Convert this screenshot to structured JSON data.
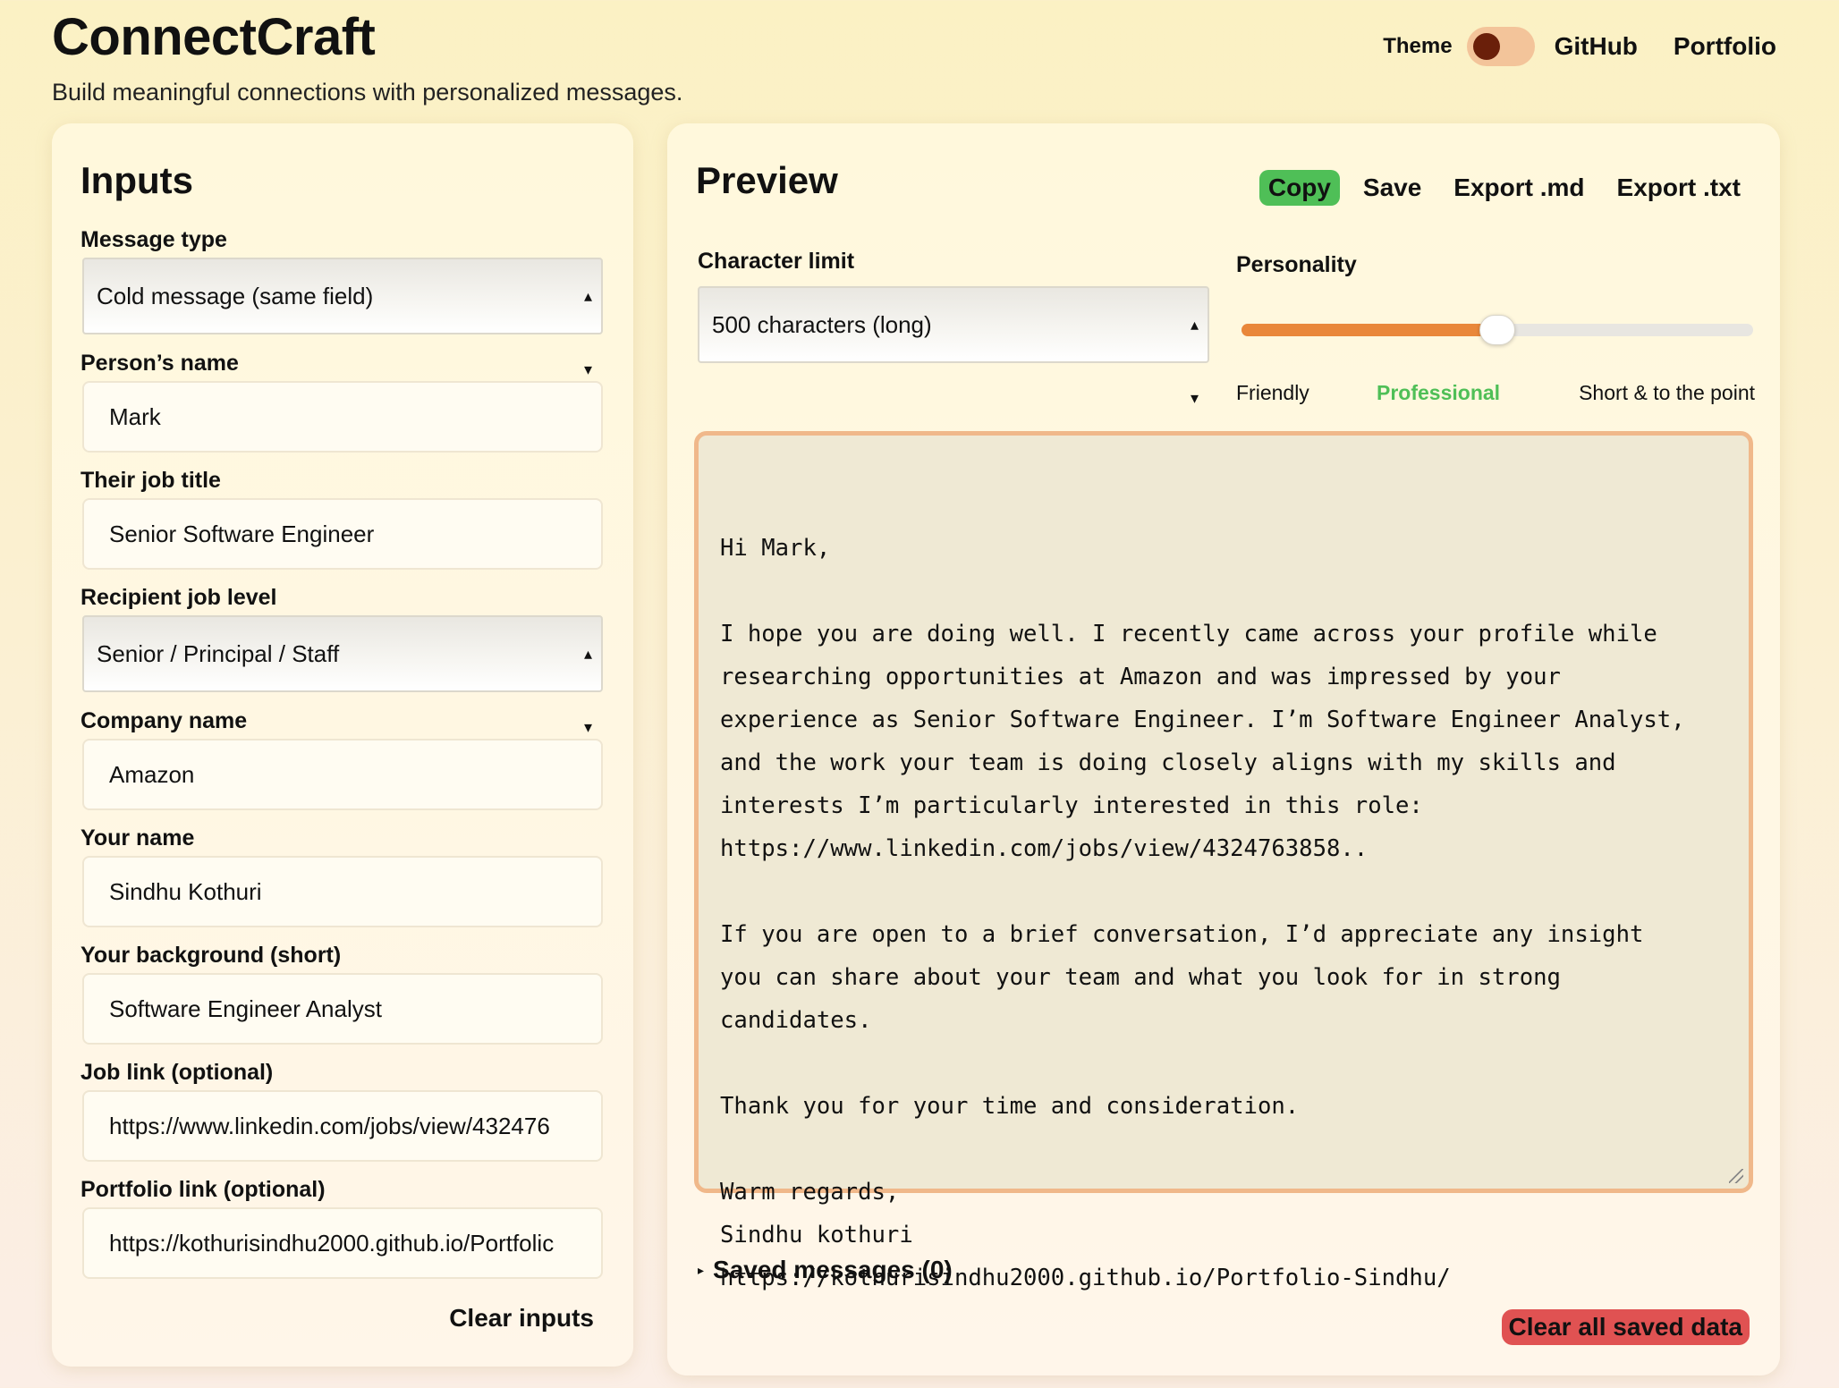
{
  "header": {
    "title": "ConnectCraft",
    "subtitle": "Build meaningful connections with personalized messages.",
    "theme_label": "Theme",
    "nav": [
      "GitHub",
      "Portfolio"
    ]
  },
  "inputs": {
    "title": "Inputs",
    "message_type": {
      "label": "Message type",
      "value": "Cold message (same field)"
    },
    "person_name": {
      "label": "Person’s name",
      "value": "Mark"
    },
    "job_title": {
      "label": "Their job title",
      "value": "Senior Software Engineer"
    },
    "job_level": {
      "label": "Recipient job level",
      "value": "Senior / Principal / Staff"
    },
    "company": {
      "label": "Company name",
      "value": "Amazon"
    },
    "your_name": {
      "label": "Your name",
      "value": "Sindhu Kothuri"
    },
    "background": {
      "label": "Your background (short)",
      "value": "Software Engineer Analyst"
    },
    "job_link": {
      "label": "Job link (optional)",
      "value": "https://www.linkedin.com/jobs/view/432476"
    },
    "portfolio_link": {
      "label": "Portfolio link (optional)",
      "value": "https://kothurisindhu2000.github.io/Portfolic"
    },
    "clear_label": "Clear inputs"
  },
  "preview": {
    "title": "Preview",
    "actions": {
      "copy": "Copy",
      "save": "Save",
      "export_md": "Export .md",
      "export_txt": "Export .txt"
    },
    "char_limit": {
      "label": "Character limit",
      "value": "500 characters (long)"
    },
    "personality": {
      "label": "Personality",
      "options": [
        "Friendly",
        "Professional",
        "Short & to the point"
      ],
      "selected": "Professional",
      "level": 0.5
    },
    "message": "Hi Mark,\n\nI hope you are doing well. I recently came across your profile while\nresearching opportunities at Amazon and was impressed by your\nexperience as Senior Software Engineer. I’m Software Engineer Analyst,\nand the work your team is doing closely aligns with my skills and\ninterests I’m particularly interested in this role:\nhttps://www.linkedin.com/jobs/view/4324763858..\n\nIf you are open to a brief conversation, I’d appreciate any insight\nyou can share about your team and what you look for in strong\ncandidates.\n\nThank you for your time and consideration.\n\nWarm regards,\nSindhu kothuri\nhttps://kothurisindhu2000.github.io/Portfolio-Sindhu/",
    "saved_messages": "Saved messages (0)",
    "clear_all": "Clear all saved data"
  },
  "colors": {
    "accent_green": "#4fbf57",
    "accent_orange": "#e9873a",
    "danger_red": "#e05252",
    "message_border": "#f0b88a"
  },
  "icons": [
    "select-arrows-icon",
    "disclosure-triangle-icon",
    "resize-grip-icon",
    "theme-toggle-knob"
  ]
}
